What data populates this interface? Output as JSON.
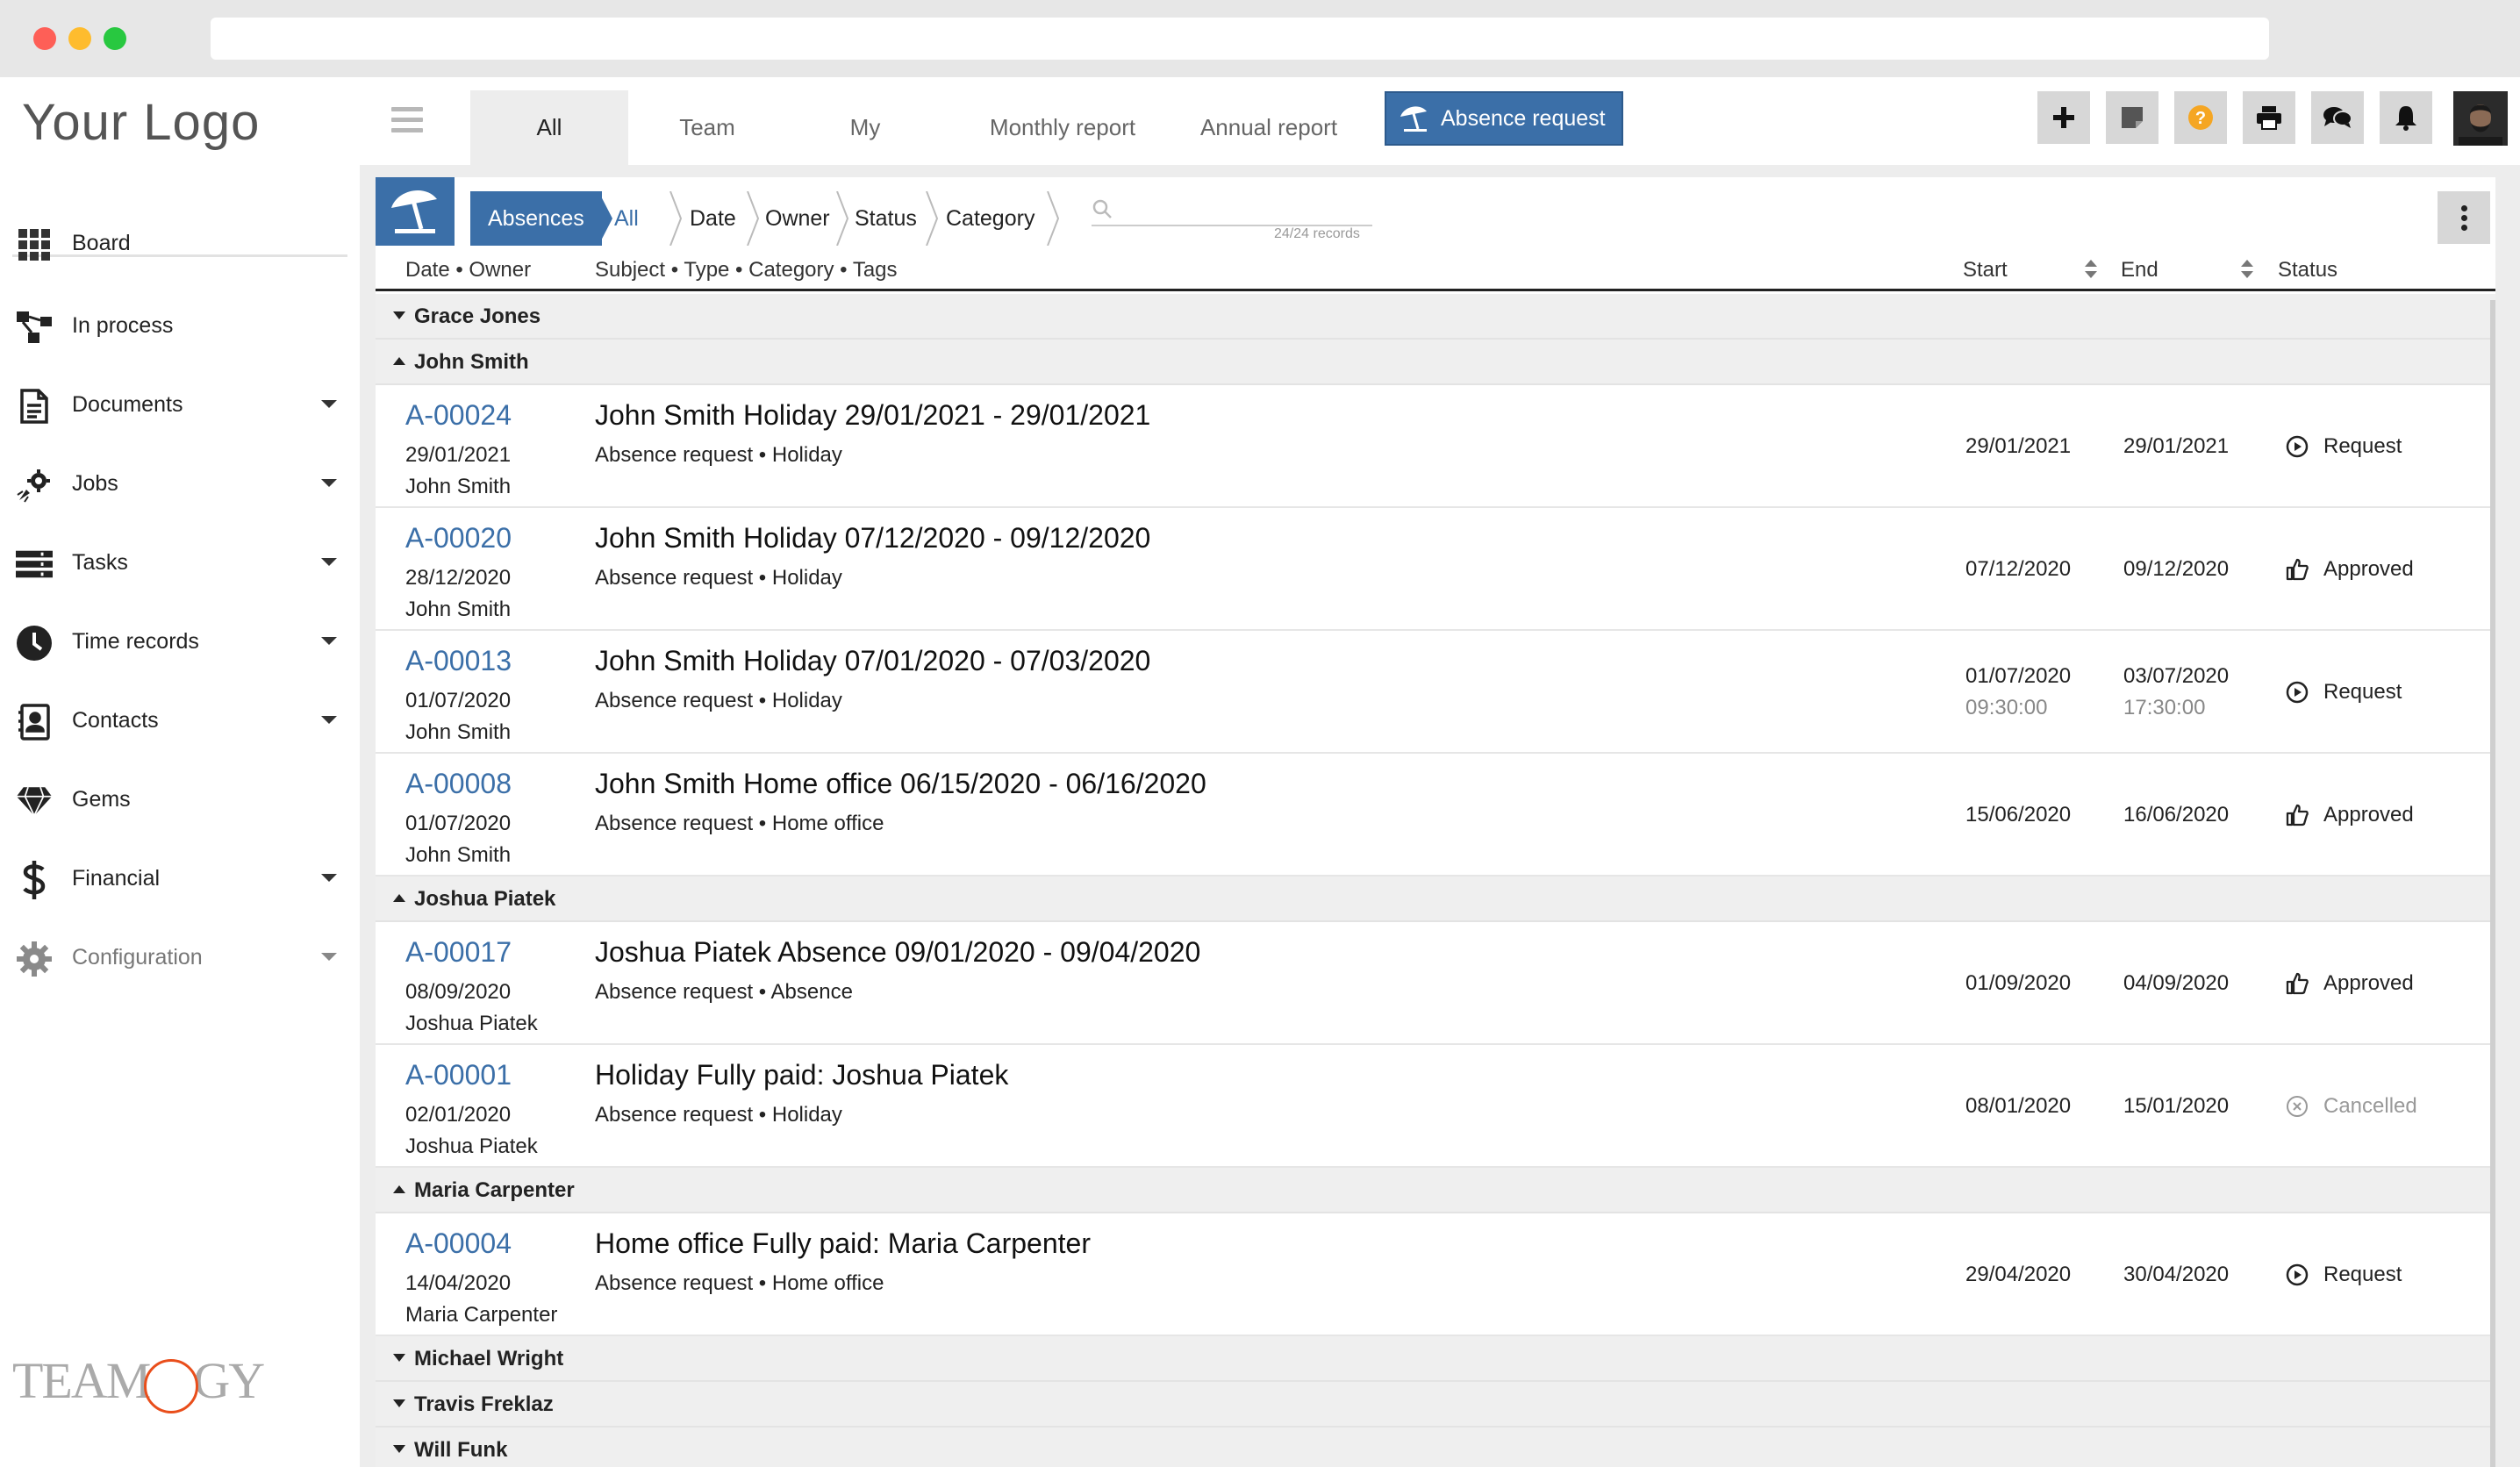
{
  "sidebar": {
    "logo": "Your Logo",
    "brand": {
      "left": "TEAM",
      "right": "GY"
    },
    "items": [
      {
        "label": "Board",
        "icon": "grid-icon",
        "caret": false
      },
      {
        "label": "In process",
        "icon": "workflow-icon",
        "caret": false
      },
      {
        "label": "Documents",
        "icon": "document-icon",
        "caret": true
      },
      {
        "label": "Jobs",
        "icon": "gear-rocket-icon",
        "caret": true
      },
      {
        "label": "Tasks",
        "icon": "tasks-icon",
        "caret": true
      },
      {
        "label": "Time records",
        "icon": "clock-icon",
        "caret": true
      },
      {
        "label": "Contacts",
        "icon": "contact-card-icon",
        "caret": true
      },
      {
        "label": "Gems",
        "icon": "gem-icon",
        "caret": false
      },
      {
        "label": "Financial",
        "icon": "dollar-icon",
        "caret": true
      },
      {
        "label": "Configuration",
        "icon": "gear-icon",
        "caret": true
      }
    ]
  },
  "topbar": {
    "tabs": [
      {
        "label": "All",
        "active": true
      },
      {
        "label": "Team",
        "active": false
      },
      {
        "label": "My",
        "active": false
      },
      {
        "label": "Monthly report",
        "active": false
      },
      {
        "label": "Annual report",
        "active": false
      }
    ],
    "action_label": "Absence request",
    "buttons": [
      "plus-icon",
      "sticky-note-icon",
      "help-icon",
      "print-icon",
      "chat-icon",
      "bell-icon"
    ]
  },
  "filter": {
    "module": "Absences",
    "view": "All",
    "crumbs": [
      "Date",
      "Owner",
      "Status",
      "Category"
    ],
    "records": "24/24 records"
  },
  "columns": {
    "date_owner": "Date • Owner",
    "subject": "Subject • Type • Category • Tags",
    "start": "Start",
    "end": "End",
    "status": "Status"
  },
  "groups": [
    {
      "name": "Grace Jones",
      "expanded": false,
      "records": []
    },
    {
      "name": "John Smith",
      "expanded": true,
      "records": [
        {
          "code": "A-00024",
          "date": "29/01/2021",
          "owner": "John Smith",
          "subject": "John Smith Holiday 29/01/2021 - 29/01/2021",
          "meta": "Absence request • Holiday",
          "start": "29/01/2021",
          "start_time": "",
          "end": "29/01/2021",
          "end_time": "",
          "status": "Request",
          "status_icon": "play-circle-icon"
        },
        {
          "code": "A-00020",
          "date": "28/12/2020",
          "owner": "John Smith",
          "subject": "John Smith Holiday 07/12/2020 - 09/12/2020",
          "meta": "Absence request • Holiday",
          "start": "07/12/2020",
          "start_time": "",
          "end": "09/12/2020",
          "end_time": "",
          "status": "Approved",
          "status_icon": "thumbs-up-icon"
        },
        {
          "code": "A-00013",
          "date": "01/07/2020",
          "owner": "John Smith",
          "subject": "John Smith Holiday 07/01/2020 - 07/03/2020",
          "meta": "Absence request • Holiday",
          "start": "01/07/2020",
          "start_time": "09:30:00",
          "end": "03/07/2020",
          "end_time": "17:30:00",
          "status": "Request",
          "status_icon": "play-circle-icon"
        },
        {
          "code": "A-00008",
          "date": "01/07/2020",
          "owner": "John Smith",
          "subject": "John Smith Home office 06/15/2020 - 06/16/2020",
          "meta": "Absence request • Home office",
          "start": "15/06/2020",
          "start_time": "",
          "end": "16/06/2020",
          "end_time": "",
          "status": "Approved",
          "status_icon": "thumbs-up-icon"
        }
      ]
    },
    {
      "name": "Joshua Piatek",
      "expanded": true,
      "records": [
        {
          "code": "A-00017",
          "date": "08/09/2020",
          "owner": "Joshua Piatek",
          "subject": "Joshua Piatek Absence 09/01/2020 - 09/04/2020",
          "meta": "Absence request • Absence",
          "start": "01/09/2020",
          "start_time": "",
          "end": "04/09/2020",
          "end_time": "",
          "status": "Approved",
          "status_icon": "thumbs-up-icon"
        },
        {
          "code": "A-00001",
          "date": "02/01/2020",
          "owner": "Joshua Piatek",
          "subject": "Holiday Fully paid: Joshua Piatek",
          "meta": "Absence request • Holiday",
          "start": "08/01/2020",
          "start_time": "",
          "end": "15/01/2020",
          "end_time": "",
          "status": "Cancelled",
          "status_icon": "cancel-circle-icon"
        }
      ]
    },
    {
      "name": "Maria Carpenter",
      "expanded": true,
      "records": [
        {
          "code": "A-00004",
          "date": "14/04/2020",
          "owner": "Maria Carpenter",
          "subject": "Home office Fully paid: Maria Carpenter",
          "meta": "Absence request • Home office",
          "start": "29/04/2020",
          "start_time": "",
          "end": "30/04/2020",
          "end_time": "",
          "status": "Request",
          "status_icon": "play-circle-icon"
        }
      ]
    },
    {
      "name": "Michael Wright",
      "expanded": false,
      "records": []
    },
    {
      "name": "Travis Freklaz",
      "expanded": false,
      "records": []
    },
    {
      "name": "Will Funk",
      "expanded": false,
      "records": []
    }
  ],
  "colors": {
    "accent": "#3b6fa8",
    "help": "#f5a623",
    "cancelled": "#999999"
  }
}
